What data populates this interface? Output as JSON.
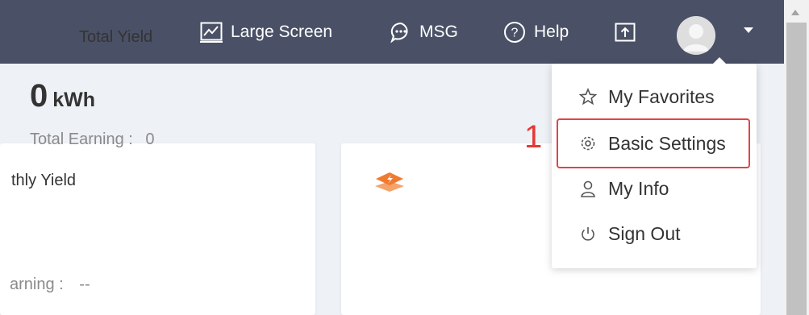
{
  "header": {
    "large_screen_label": "Large Screen",
    "msg_label": "MSG",
    "help_label": "Help"
  },
  "cards": {
    "monthly": {
      "title": "thly Yield",
      "earning_label": "arning :",
      "earning_value": "--"
    },
    "total": {
      "title": "Total Yield",
      "value": "0",
      "unit": "kWh",
      "earning_label": "Total Earning :",
      "earning_value": "0"
    }
  },
  "user_menu": {
    "items": [
      {
        "label": "My Favorites",
        "icon": "star-icon"
      },
      {
        "label": "Basic Settings",
        "icon": "gear-icon"
      },
      {
        "label": "My Info",
        "icon": "user-icon"
      },
      {
        "label": "Sign Out",
        "icon": "power-icon"
      }
    ]
  },
  "annotation": {
    "step": "1",
    "color": "#e53935"
  },
  "colors": {
    "header_bg": "#4a5166",
    "page_bg": "#eef1f6",
    "accent_orange": "#f07a30"
  }
}
